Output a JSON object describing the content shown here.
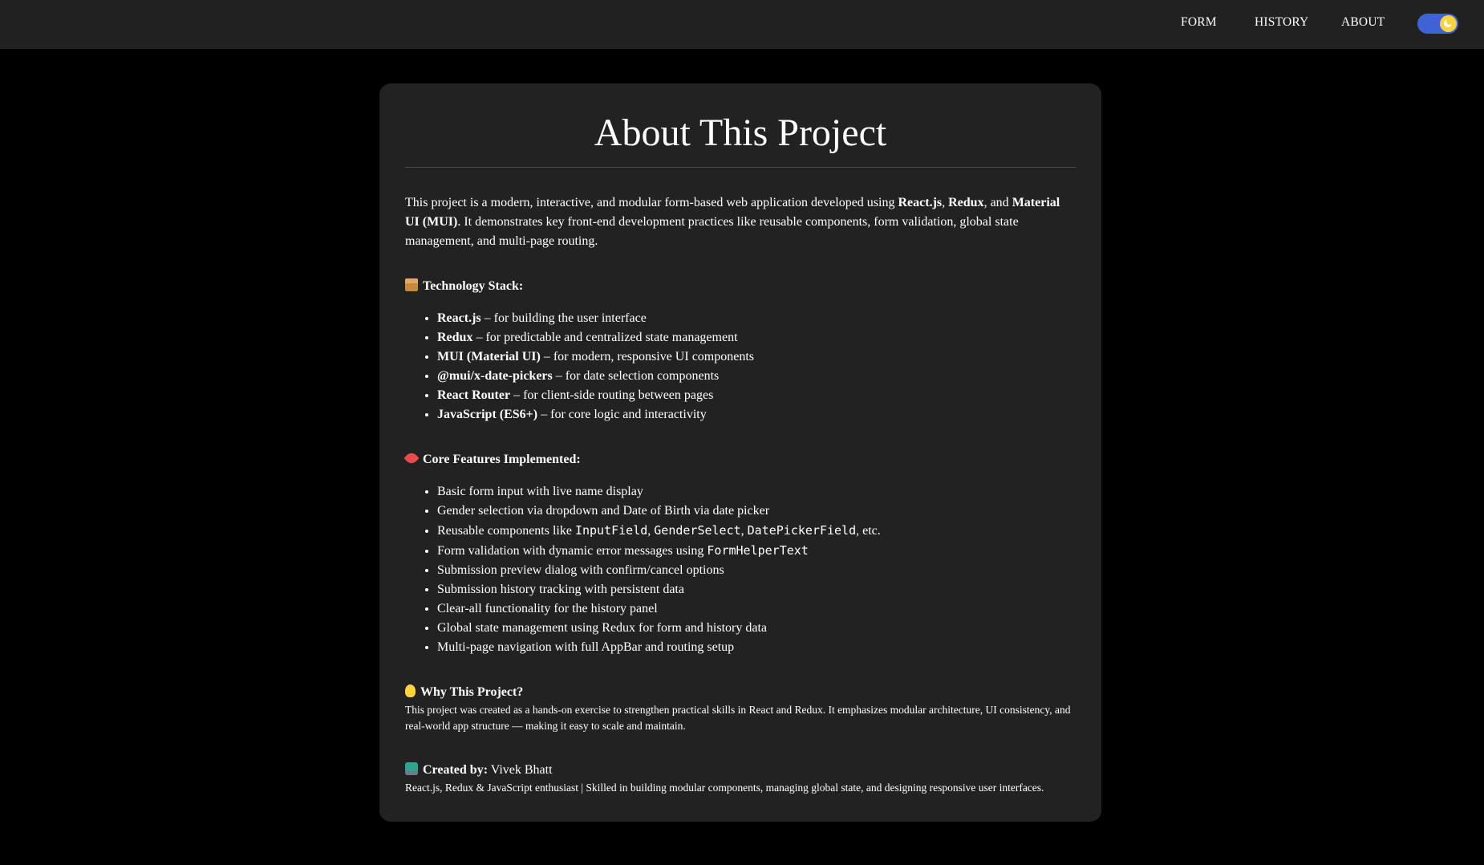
{
  "nav": {
    "links": [
      "FORM",
      "HISTORY",
      "ABOUT"
    ],
    "theme_toggle_icon": "moon-icon",
    "accent": "#3f63d6"
  },
  "page": {
    "title": "About This Project",
    "intro": {
      "p1": "This project is a modern, interactive, and modular form-based web application developed using ",
      "b1": "React.js",
      "p2": ", ",
      "b2": "Redux",
      "p3": ", and ",
      "b3": "Material UI (MUI)",
      "p4": ". It demonstrates key front-end development practices like reusable components, form validation, global state management, and multi-page routing."
    },
    "tech": {
      "heading": "Technology Stack:",
      "icon": "package-icon",
      "items": [
        {
          "name": "React.js",
          "desc": " – for building the user interface"
        },
        {
          "name": "Redux",
          "desc": " – for predictable and centralized state management"
        },
        {
          "name": "MUI (Material UI)",
          "desc": " – for modern, responsive UI components"
        },
        {
          "name": "@mui/x-date-pickers",
          "desc": " – for date selection components"
        },
        {
          "name": "React Router",
          "desc": " – for client-side routing between pages"
        },
        {
          "name": "JavaScript (ES6+)",
          "desc": " – for core logic and interactivity"
        }
      ]
    },
    "features": {
      "heading": "Core Features Implemented:",
      "icon": "rocket-icon",
      "item0": "Basic form input with live name display",
      "item1": "Gender selection via dropdown and Date of Birth via date picker",
      "item2": {
        "pre": "Reusable components like ",
        "c1": "InputField",
        "s1": ", ",
        "c2": "GenderSelect",
        "s2": ", ",
        "c3": "DatePickerField",
        "post": ", etc."
      },
      "item3": {
        "pre": "Form validation with dynamic error messages using ",
        "c1": "FormHelperText"
      },
      "item4": "Submission preview dialog with confirm/cancel options",
      "item5": "Submission history tracking with persistent data",
      "item6": "Clear-all functionality for the history panel",
      "item7": "Global state management using Redux for form and history data",
      "item8": "Multi-page navigation with full AppBar and routing setup"
    },
    "why": {
      "heading": "Why This Project?",
      "icon": "lightbulb-icon",
      "text": "This project was created as a hands-on exercise to strengthen practical skills in React and Redux. It emphasizes modular architecture, UI consistency, and real-world app structure — making it easy to scale and maintain."
    },
    "credit": {
      "label": "Created by:",
      "name": " Vivek Bhatt",
      "icon": "developer-icon",
      "tagline": "React.js, Redux & JavaScript enthusiast | Skilled in building modular components, managing global state, and designing responsive user interfaces."
    }
  }
}
